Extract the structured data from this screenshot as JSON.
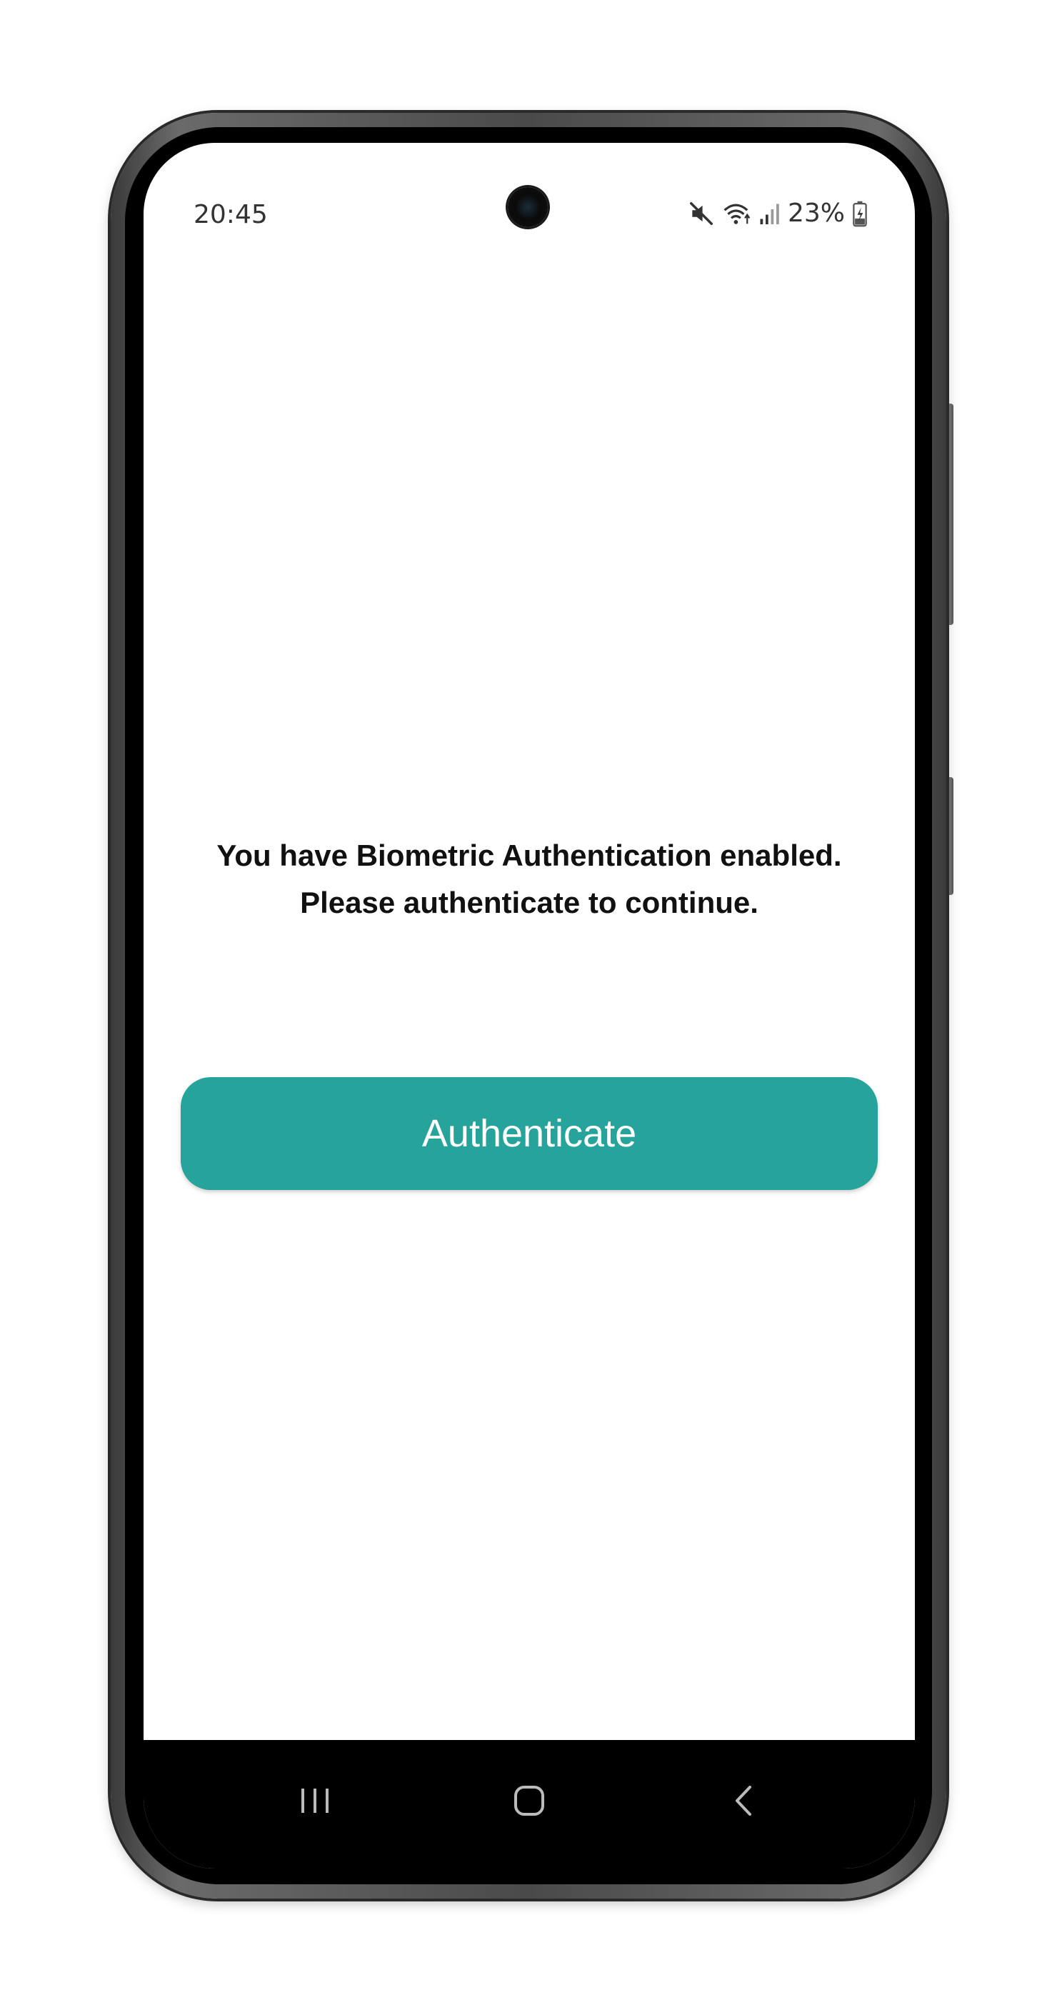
{
  "status_bar": {
    "time": "20:45",
    "battery": "23%",
    "icons": [
      "mute-icon",
      "wifi-icon",
      "signal-icon",
      "battery-charging-icon"
    ]
  },
  "main": {
    "message_line1": "You have Biometric Authentication enabled.",
    "message_line2": "Please authenticate to continue.",
    "authenticate_label": "Authenticate"
  },
  "nav_bar": {
    "items": [
      "recents-icon",
      "home-icon",
      "back-icon"
    ]
  },
  "colors": {
    "accent": "#26a39a",
    "nav_background": "#000000",
    "screen_background": "#ffffff"
  }
}
